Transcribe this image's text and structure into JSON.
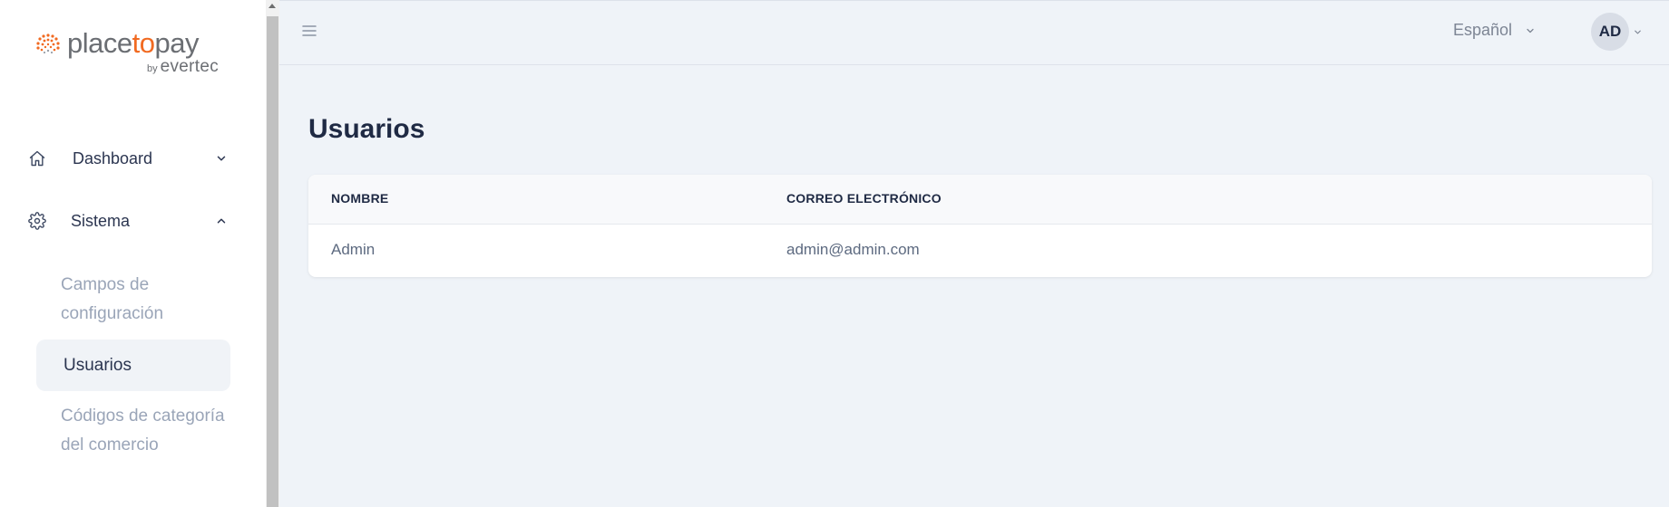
{
  "brand": {
    "name_part1": "place",
    "name_accent": "to",
    "name_part2": "pay",
    "by": "by",
    "company": "evertec",
    "accent_color": "#f16a21"
  },
  "sidebar": {
    "items": [
      {
        "label": "Dashboard",
        "icon": "home-icon",
        "expanded": false
      },
      {
        "label": "Sistema",
        "icon": "gear-icon",
        "expanded": true,
        "children": [
          {
            "label": "Campos de configuración",
            "active": false
          },
          {
            "label": "Usuarios",
            "active": true
          },
          {
            "label": "Códigos de categoría del comercio",
            "active": false
          }
        ]
      }
    ]
  },
  "topbar": {
    "menu_icon": "hamburger-icon",
    "language": "Español",
    "user_initials": "AD"
  },
  "main": {
    "title": "Usuarios",
    "table": {
      "columns": [
        "NOMBRE",
        "CORREO ELECTRÓNICO"
      ],
      "rows": [
        [
          "Admin",
          "admin@admin.com"
        ]
      ]
    }
  }
}
